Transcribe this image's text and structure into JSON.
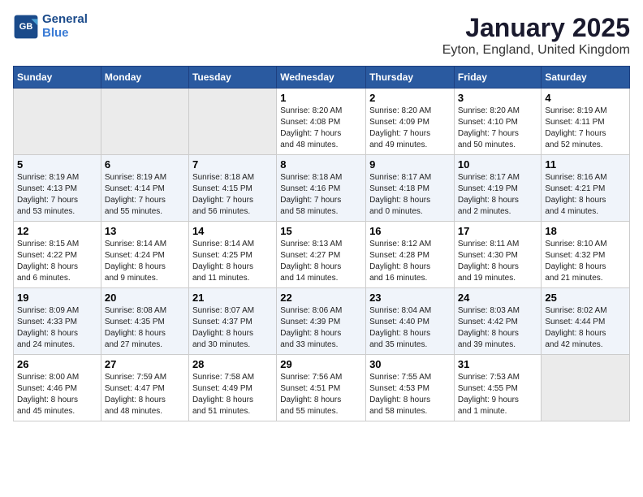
{
  "header": {
    "logo_line1": "General",
    "logo_line2": "Blue",
    "title": "January 2025",
    "subtitle": "Eyton, England, United Kingdom"
  },
  "weekdays": [
    "Sunday",
    "Monday",
    "Tuesday",
    "Wednesday",
    "Thursday",
    "Friday",
    "Saturday"
  ],
  "weeks": [
    [
      {
        "day": "",
        "info": ""
      },
      {
        "day": "",
        "info": ""
      },
      {
        "day": "",
        "info": ""
      },
      {
        "day": "1",
        "info": "Sunrise: 8:20 AM\nSunset: 4:08 PM\nDaylight: 7 hours\nand 48 minutes."
      },
      {
        "day": "2",
        "info": "Sunrise: 8:20 AM\nSunset: 4:09 PM\nDaylight: 7 hours\nand 49 minutes."
      },
      {
        "day": "3",
        "info": "Sunrise: 8:20 AM\nSunset: 4:10 PM\nDaylight: 7 hours\nand 50 minutes."
      },
      {
        "day": "4",
        "info": "Sunrise: 8:19 AM\nSunset: 4:11 PM\nDaylight: 7 hours\nand 52 minutes."
      }
    ],
    [
      {
        "day": "5",
        "info": "Sunrise: 8:19 AM\nSunset: 4:13 PM\nDaylight: 7 hours\nand 53 minutes."
      },
      {
        "day": "6",
        "info": "Sunrise: 8:19 AM\nSunset: 4:14 PM\nDaylight: 7 hours\nand 55 minutes."
      },
      {
        "day": "7",
        "info": "Sunrise: 8:18 AM\nSunset: 4:15 PM\nDaylight: 7 hours\nand 56 minutes."
      },
      {
        "day": "8",
        "info": "Sunrise: 8:18 AM\nSunset: 4:16 PM\nDaylight: 7 hours\nand 58 minutes."
      },
      {
        "day": "9",
        "info": "Sunrise: 8:17 AM\nSunset: 4:18 PM\nDaylight: 8 hours\nand 0 minutes."
      },
      {
        "day": "10",
        "info": "Sunrise: 8:17 AM\nSunset: 4:19 PM\nDaylight: 8 hours\nand 2 minutes."
      },
      {
        "day": "11",
        "info": "Sunrise: 8:16 AM\nSunset: 4:21 PM\nDaylight: 8 hours\nand 4 minutes."
      }
    ],
    [
      {
        "day": "12",
        "info": "Sunrise: 8:15 AM\nSunset: 4:22 PM\nDaylight: 8 hours\nand 6 minutes."
      },
      {
        "day": "13",
        "info": "Sunrise: 8:14 AM\nSunset: 4:24 PM\nDaylight: 8 hours\nand 9 minutes."
      },
      {
        "day": "14",
        "info": "Sunrise: 8:14 AM\nSunset: 4:25 PM\nDaylight: 8 hours\nand 11 minutes."
      },
      {
        "day": "15",
        "info": "Sunrise: 8:13 AM\nSunset: 4:27 PM\nDaylight: 8 hours\nand 14 minutes."
      },
      {
        "day": "16",
        "info": "Sunrise: 8:12 AM\nSunset: 4:28 PM\nDaylight: 8 hours\nand 16 minutes."
      },
      {
        "day": "17",
        "info": "Sunrise: 8:11 AM\nSunset: 4:30 PM\nDaylight: 8 hours\nand 19 minutes."
      },
      {
        "day": "18",
        "info": "Sunrise: 8:10 AM\nSunset: 4:32 PM\nDaylight: 8 hours\nand 21 minutes."
      }
    ],
    [
      {
        "day": "19",
        "info": "Sunrise: 8:09 AM\nSunset: 4:33 PM\nDaylight: 8 hours\nand 24 minutes."
      },
      {
        "day": "20",
        "info": "Sunrise: 8:08 AM\nSunset: 4:35 PM\nDaylight: 8 hours\nand 27 minutes."
      },
      {
        "day": "21",
        "info": "Sunrise: 8:07 AM\nSunset: 4:37 PM\nDaylight: 8 hours\nand 30 minutes."
      },
      {
        "day": "22",
        "info": "Sunrise: 8:06 AM\nSunset: 4:39 PM\nDaylight: 8 hours\nand 33 minutes."
      },
      {
        "day": "23",
        "info": "Sunrise: 8:04 AM\nSunset: 4:40 PM\nDaylight: 8 hours\nand 35 minutes."
      },
      {
        "day": "24",
        "info": "Sunrise: 8:03 AM\nSunset: 4:42 PM\nDaylight: 8 hours\nand 39 minutes."
      },
      {
        "day": "25",
        "info": "Sunrise: 8:02 AM\nSunset: 4:44 PM\nDaylight: 8 hours\nand 42 minutes."
      }
    ],
    [
      {
        "day": "26",
        "info": "Sunrise: 8:00 AM\nSunset: 4:46 PM\nDaylight: 8 hours\nand 45 minutes."
      },
      {
        "day": "27",
        "info": "Sunrise: 7:59 AM\nSunset: 4:47 PM\nDaylight: 8 hours\nand 48 minutes."
      },
      {
        "day": "28",
        "info": "Sunrise: 7:58 AM\nSunset: 4:49 PM\nDaylight: 8 hours\nand 51 minutes."
      },
      {
        "day": "29",
        "info": "Sunrise: 7:56 AM\nSunset: 4:51 PM\nDaylight: 8 hours\nand 55 minutes."
      },
      {
        "day": "30",
        "info": "Sunrise: 7:55 AM\nSunset: 4:53 PM\nDaylight: 8 hours\nand 58 minutes."
      },
      {
        "day": "31",
        "info": "Sunrise: 7:53 AM\nSunset: 4:55 PM\nDaylight: 9 hours\nand 1 minute."
      },
      {
        "day": "",
        "info": ""
      }
    ]
  ]
}
